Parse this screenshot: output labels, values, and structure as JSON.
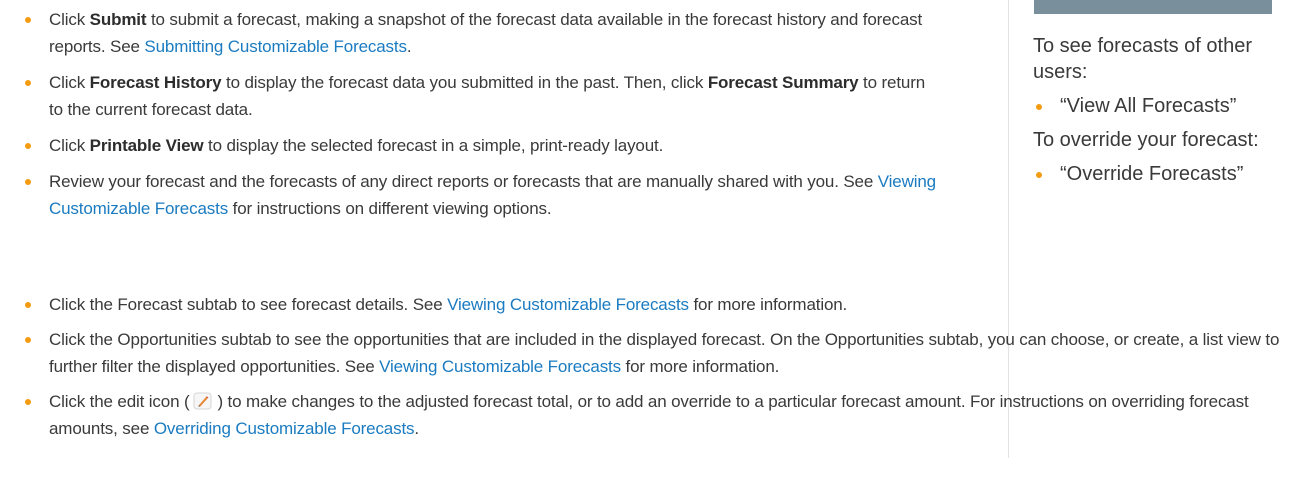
{
  "colors": {
    "bullet": "#f39c12",
    "link": "#1b7bc0",
    "text": "#3a3a3a",
    "sidebar_header": "#7a8f9c"
  },
  "top_list": [
    {
      "t1": "Click ",
      "b1": "Submit",
      "t2": " to submit a forecast, making a snapshot of the forecast data available in the forecast history and forecast reports. See ",
      "link": "Submitting Customizable Forecasts",
      "t3": "."
    },
    {
      "t1": "Click ",
      "b1": "Forecast History",
      "t2": " to display the forecast data you submitted in the past. Then, click ",
      "b2": "Forecast Summary",
      "t3": " to return to the current forecast data."
    },
    {
      "t1": "Click ",
      "b1": "Printable View",
      "t2": " to display the selected forecast in a simple, print-ready layout."
    },
    {
      "t1": "Review your forecast and the forecasts of any direct reports or forecasts that are manually shared with you. See ",
      "link": "Viewing Customizable Forecasts",
      "t2": " for instructions on different viewing options."
    }
  ],
  "bottom_list": [
    {
      "t1": "Click the Forecast subtab to see forecast details. See ",
      "link": "Viewing Customizable Forecasts",
      "t2": " for more information."
    },
    {
      "t1": "Click the Opportunities subtab to see the opportunities that are included in the displayed forecast. On the Opportunities subtab, you can choose, or create, a list view to further filter the displayed opportunities. See ",
      "link": "Viewing Customizable Forecasts",
      "t2": " for more information."
    },
    {
      "t1": "Click the edit icon (",
      "icon": "edit-pencil-icon",
      "t2": ") to make changes to the adjusted forecast total, or to add an override to a particular forecast amount. For instructions on overriding forecast amounts, see ",
      "link": "Overriding Customizable Forecasts",
      "t3": "."
    }
  ],
  "sidebar": {
    "req1_label": "To see forecasts of other users:",
    "req1_item": "“View All Forecasts”",
    "req2_label": "To override your forecast:",
    "req2_item": "“Override Forecasts”"
  }
}
